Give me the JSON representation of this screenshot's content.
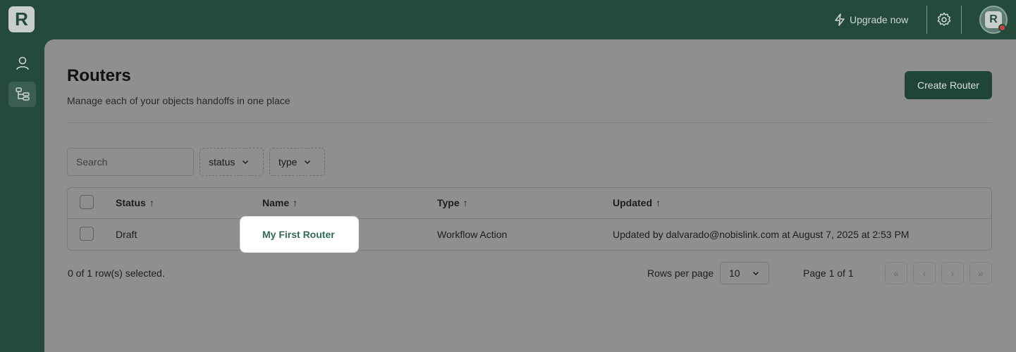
{
  "app": {
    "logo_letter": "R"
  },
  "header": {
    "upgrade_label": "Upgrade now",
    "avatar_letter": "R"
  },
  "sidebar": {
    "items": [
      {
        "icon": "user-icon"
      },
      {
        "icon": "routers-icon",
        "active": true
      }
    ]
  },
  "page": {
    "title": "Routers",
    "subtitle": "Manage each of your objects handoffs in one place",
    "create_button": "Create Router"
  },
  "filters": {
    "search_placeholder": "Search",
    "status_label": "status",
    "type_label": "type"
  },
  "table": {
    "columns": [
      "Status",
      "Name",
      "Type",
      "Updated"
    ],
    "rows": [
      {
        "status": "Draft",
        "name": "My First Router",
        "type": "Workflow Action",
        "updated": "Updated by dalvarado@nobislink.com at August 7, 2025 at 2:53 PM"
      }
    ]
  },
  "footer": {
    "selected_text": "0 of 1 row(s) selected.",
    "rows_per_page_label": "Rows per page",
    "rows_per_page_value": "10",
    "page_text": "Page 1 of 1"
  },
  "colors": {
    "brand": "#234a3b",
    "link": "#2f6b53",
    "alert_dot": "#d1403a"
  }
}
